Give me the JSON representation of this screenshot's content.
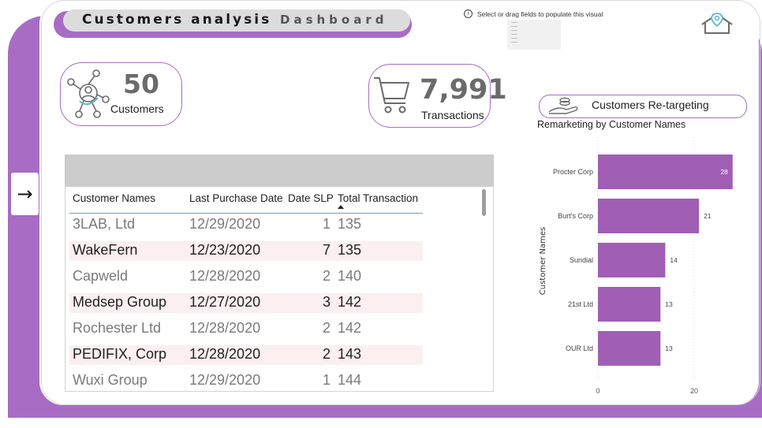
{
  "header": {
    "title_part1": "Customers analysis",
    "title_part2": "Dashboard",
    "placeholder_tip": "Select or drag fields to populate this visual",
    "info_icon": "info-icon",
    "home_icon": "home-location-icon"
  },
  "kpis": {
    "customers": {
      "value": "50",
      "label": "Customers",
      "icon": "network-people-icon"
    },
    "transactions": {
      "value": "7,991",
      "label": "Transactions",
      "icon": "shopping-cart-icon"
    }
  },
  "nav": {
    "arrow": "→",
    "icon": "arrow-right-icon"
  },
  "table": {
    "columns": [
      "Customer Names",
      "Last Purchase Date",
      "Date SLP",
      "Total Transaction"
    ],
    "sorted_column": "Total Transaction",
    "sort_direction": "ascending",
    "rows": [
      {
        "name": "3LAB, Ltd",
        "date": "12/29/2020",
        "slp": "1",
        "total": "135"
      },
      {
        "name": "WakeFern",
        "date": "12/23/2020",
        "slp": "7",
        "total": "135"
      },
      {
        "name": "Capweld",
        "date": "12/28/2020",
        "slp": "2",
        "total": "140"
      },
      {
        "name": "Medsep Group",
        "date": "12/27/2020",
        "slp": "3",
        "total": "142"
      },
      {
        "name": "Rochester Ltd",
        "date": "12/28/2020",
        "slp": "2",
        "total": "142"
      },
      {
        "name": "PEDIFIX, Corp",
        "date": "12/28/2020",
        "slp": "2",
        "total": "143"
      },
      {
        "name": "Wuxi Group",
        "date": "12/29/2020",
        "slp": "1",
        "total": "144"
      }
    ]
  },
  "retargeting": {
    "label": "Customers Re-targeting",
    "icon": "hand-coins-icon"
  },
  "colors": {
    "accent": "#a86cc4",
    "bar": "#a05eb5",
    "row_stripe": "#fbeff0",
    "header_gray": "#cccccc"
  },
  "chart_data": {
    "type": "bar",
    "orientation": "horizontal",
    "title": "Remarketing by Customer Names",
    "ylabel": "Customer Names",
    "xlabel": "",
    "categories": [
      "Procter Corp",
      "Burt's Corp",
      "Sundial",
      "21st Ltd",
      "OUR Ltd"
    ],
    "values": [
      28,
      21,
      14,
      13,
      13
    ],
    "xlim": [
      0,
      28
    ],
    "x_ticks": [
      "0",
      "20"
    ],
    "data_labels": true,
    "grid": "vertical dotted"
  }
}
